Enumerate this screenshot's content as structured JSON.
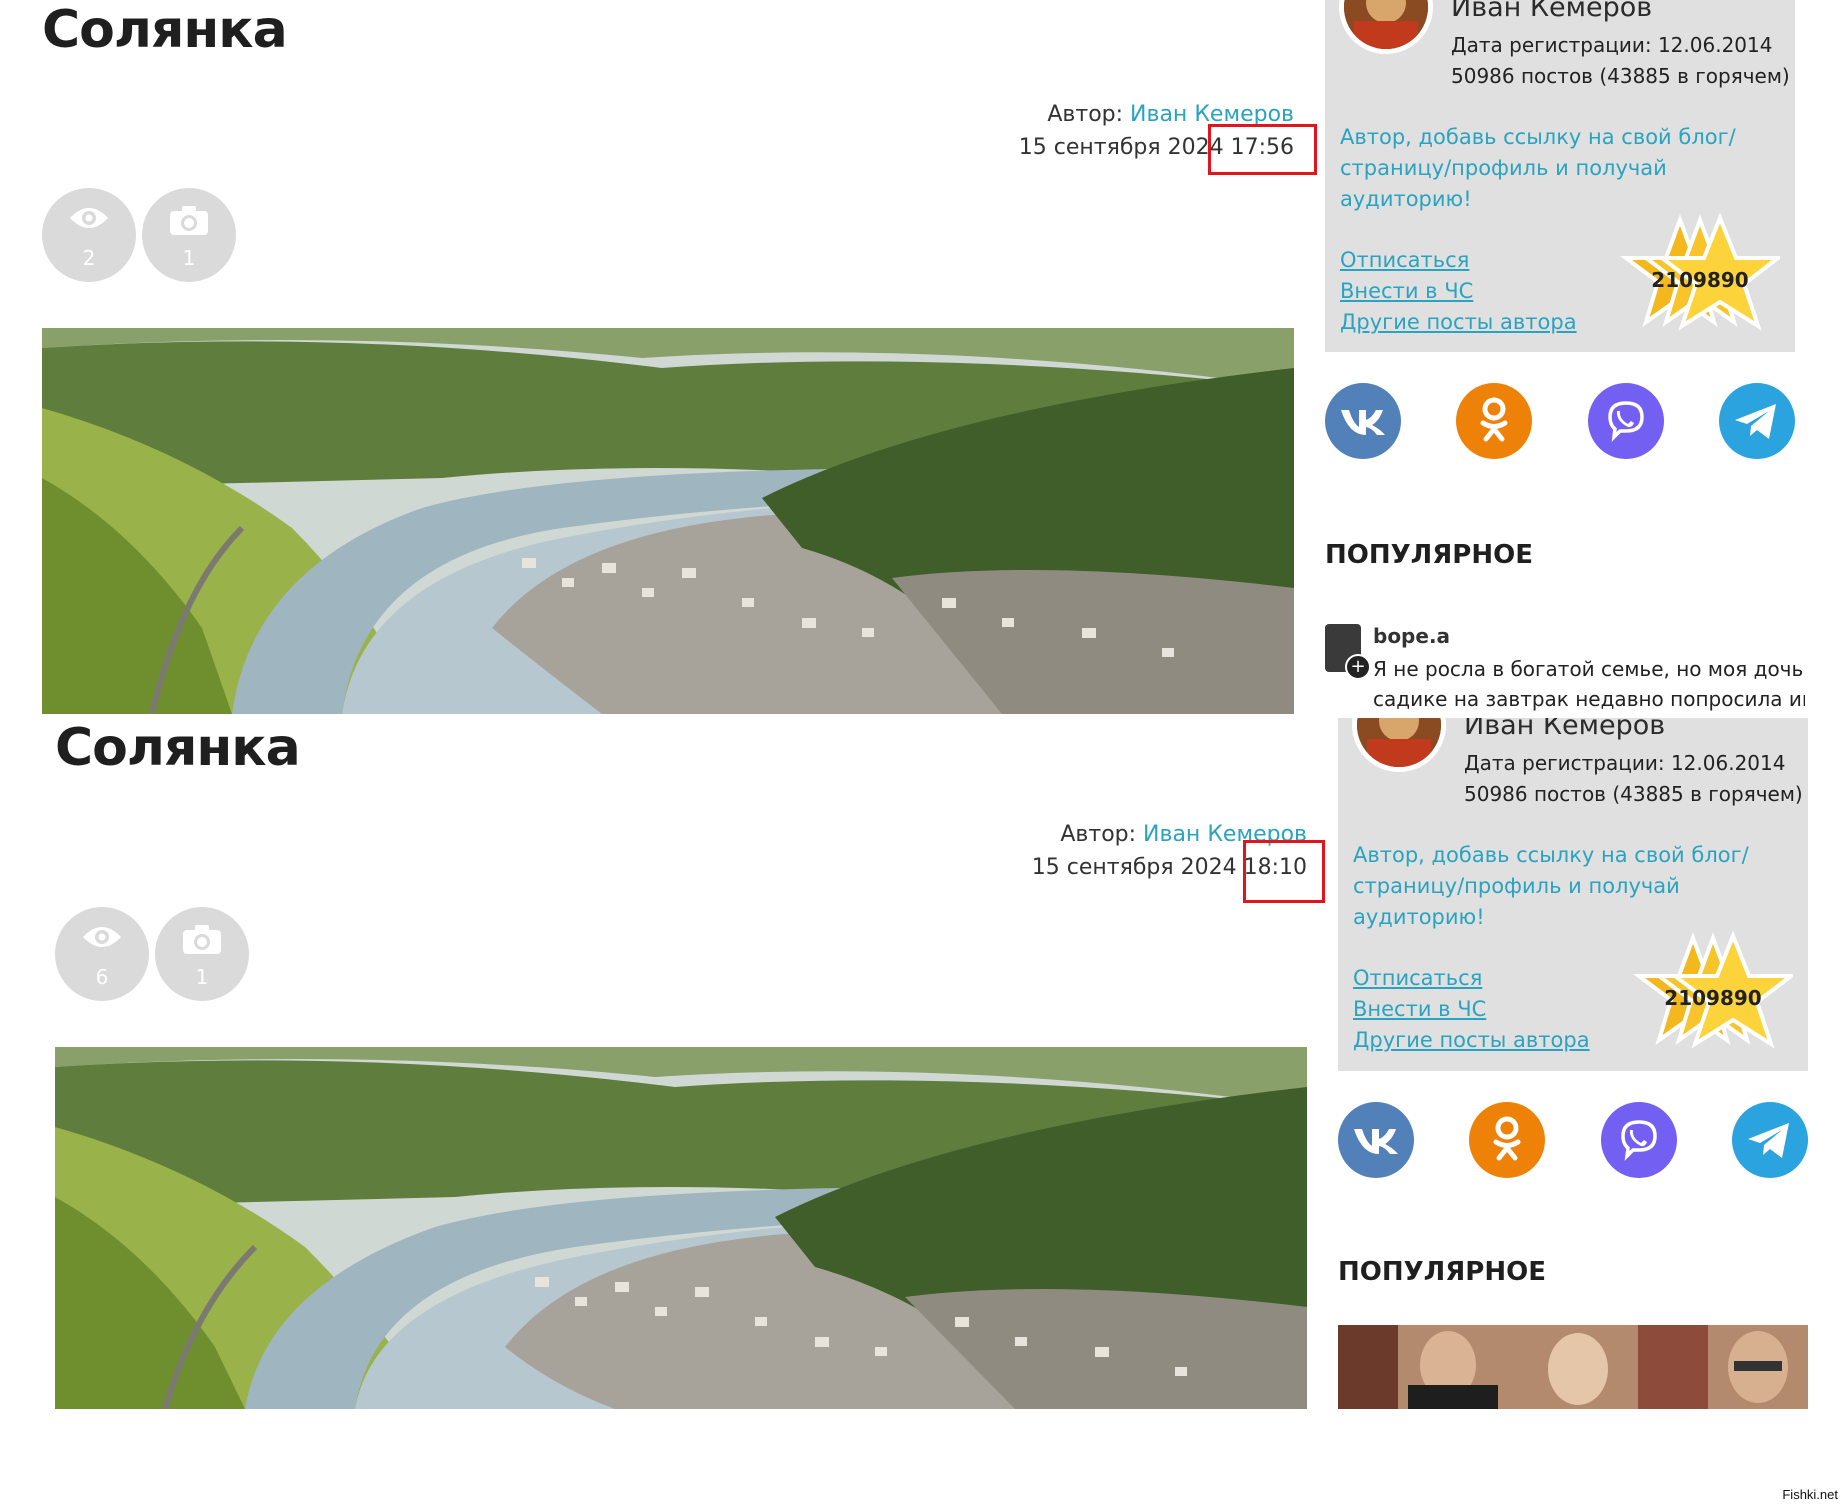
{
  "panels": [
    {
      "post_title": "Солянка",
      "author_label": "Автор:",
      "author_name": "Иван Кемеров",
      "date": "15 сентября 2024 17:56",
      "views": "2",
      "photos": "1",
      "profile": {
        "name": "Иван Кемеров",
        "registration": "Дата регистрации: 12.06.2014",
        "posts": "50986 постов (43885 в горячем)",
        "promo": "Автор, добавь ссылку на свой блог/страницу/профиль и получай аудиторию!",
        "unsubscribe": "Отписаться",
        "blacklist": "Внести в ЧС",
        "other_posts": "Другие посты автора",
        "rating": "2109890"
      },
      "popular_heading": "ПОПУЛЯРНОЕ",
      "popular_post": {
        "user": "bope.a",
        "text": "Я не росла в богатой семье, но моя дочь в садике на завтрак недавно попросила икр"
      }
    },
    {
      "post_title": "Солянка",
      "author_label": "Автор:",
      "author_name": "Иван Кемеров",
      "date": "15 сентября 2024 18:10",
      "views": "6",
      "photos": "1",
      "profile": {
        "name": "Иван Кемеров",
        "registration": "Дата регистрации: 12.06.2014",
        "posts": "50986 постов (43885 в горячем)",
        "promo": "Автор, добавь ссылку на свой блог/страницу/профиль и получай аудиторию!",
        "unsubscribe": "Отписаться",
        "blacklist": "Внести в ЧС",
        "other_posts": "Другие посты автора",
        "rating": "2109890"
      },
      "popular_heading": "ПОПУЛЯРНОЕ"
    }
  ],
  "social_icons": [
    "vk-icon",
    "odnoklassniki-icon",
    "viber-icon",
    "telegram-icon"
  ],
  "colors": {
    "link": "#2aa3c1",
    "highlight_box": "#e3141b",
    "card_bg": "#e0e0e0",
    "vk": "#5181b8",
    "ok": "#ee8208",
    "viber": "#7360f2",
    "telegram": "#2aa3df"
  },
  "watermark": "Fishki.net"
}
